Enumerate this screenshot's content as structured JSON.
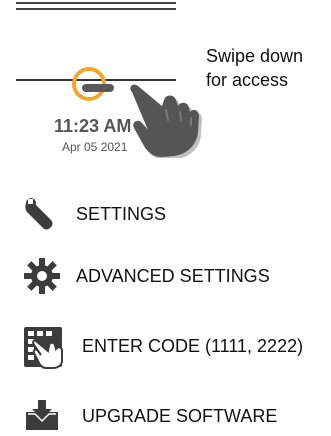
{
  "swipe_hint": {
    "line1": "Swipe down",
    "line2": "for access"
  },
  "preview": {
    "time": "11:23 AM",
    "date": "Apr 05 2021"
  },
  "colors": {
    "accent_ring": "#f4a52a",
    "icon": "#3c3c3c"
  },
  "menu": {
    "settings": {
      "label": "SETTINGS",
      "icon": "wrench-icon"
    },
    "advanced": {
      "label": "ADVANCED SETTINGS",
      "icon": "gear-icon"
    },
    "enter_code": {
      "label": "ENTER CODE (1111, 2222)",
      "icon": "hand-keypad-icon"
    },
    "upgrade": {
      "label": "UPGRADE SOFTWARE",
      "icon": "download-box-icon"
    }
  }
}
